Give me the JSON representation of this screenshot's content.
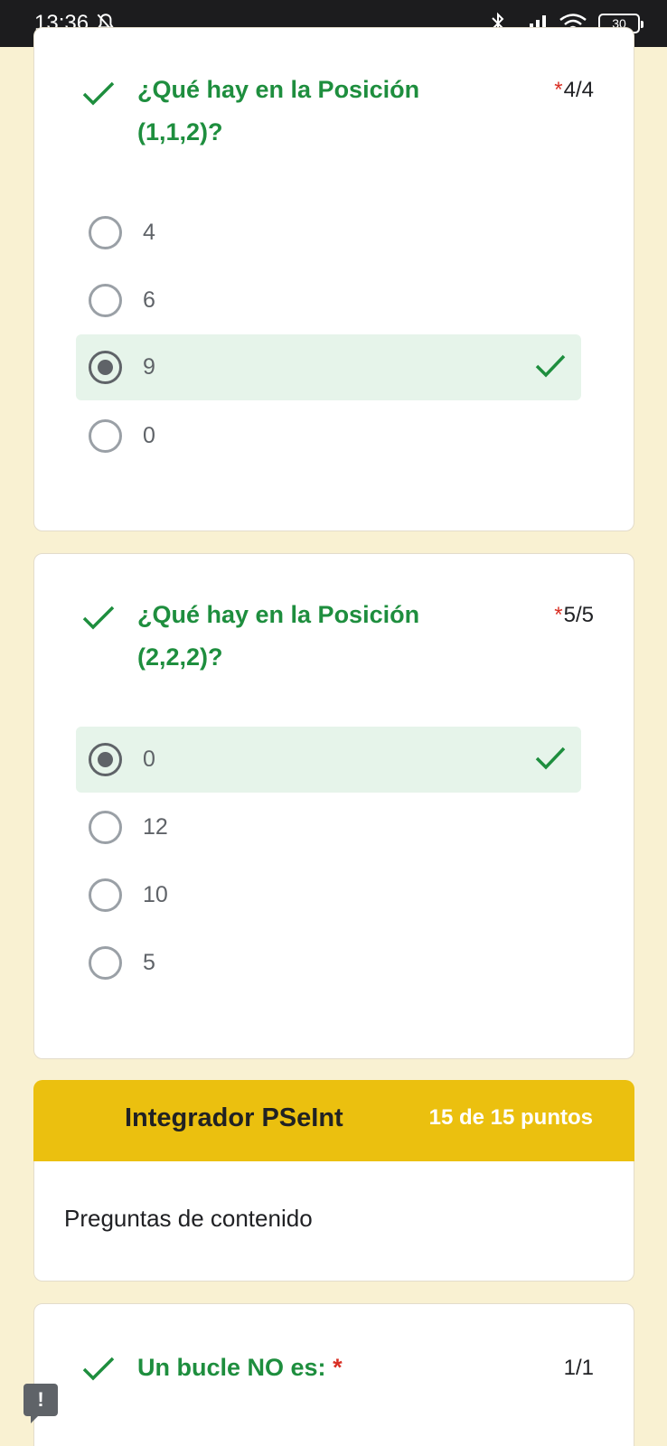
{
  "status_bar": {
    "time": "13:36",
    "icons": [
      "bell-off-icon",
      "bluetooth-icon",
      "signal-icon",
      "wifi-icon",
      "battery-icon"
    ],
    "battery_level": "30"
  },
  "questions": [
    {
      "title": "¿Qué hay en la  Posición (1,1,2)?",
      "required_mark": "*",
      "score": "4/4",
      "options": [
        {
          "label": "4",
          "selected": false
        },
        {
          "label": "6",
          "selected": false
        },
        {
          "label": "9",
          "selected": true
        },
        {
          "label": "0",
          "selected": false
        }
      ]
    },
    {
      "title": "¿Qué hay en la Posición (2,2,2)?",
      "required_mark": "*",
      "score": "5/5",
      "options": [
        {
          "label": "0",
          "selected": true
        },
        {
          "label": "12",
          "selected": false
        },
        {
          "label": "10",
          "selected": false
        },
        {
          "label": "5",
          "selected": false
        }
      ]
    }
  ],
  "section": {
    "title": "Integrador PSeInt",
    "points": "15 de 15 puntos",
    "description": "Preguntas de contenido"
  },
  "question3": {
    "title": "Un bucle NO es:",
    "required_mark": "*",
    "score": "1/1"
  },
  "colors": {
    "page_background": "#f9f1d2",
    "correct_green": "#1e8e3e",
    "selected_bg": "#e6f4ea",
    "section_header": "#ebc00f",
    "required_red": "#d93025"
  },
  "feedback_button": {
    "icon": "exclamation-icon",
    "label": "!"
  }
}
